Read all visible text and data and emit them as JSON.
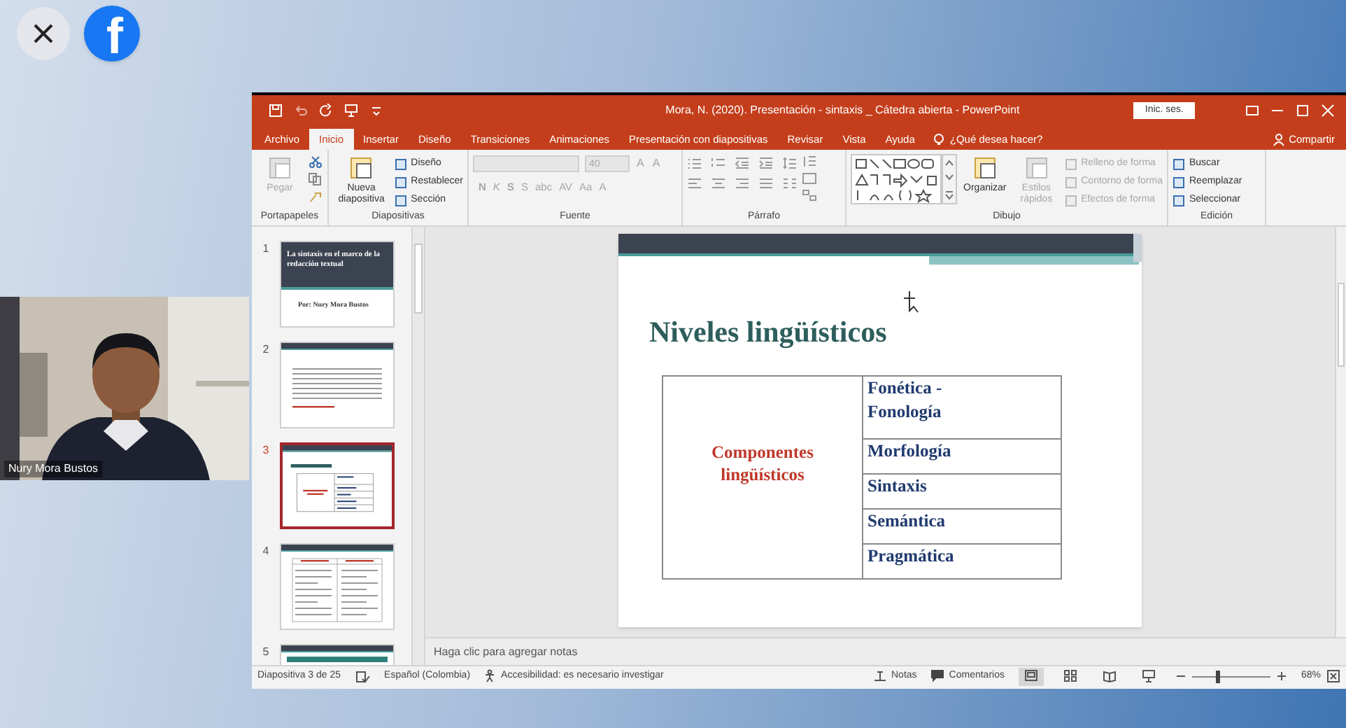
{
  "overlay": {
    "logo_letter": "f"
  },
  "webcam": {
    "name": "Nury Mora Bustos"
  },
  "powerpoint": {
    "title": "Mora, N. (2020). Presentación - sintaxis _ Cátedra abierta - PowerPoint",
    "sign_in": "Inic. ses.",
    "tabs": [
      {
        "label": "Archivo",
        "selected": false
      },
      {
        "label": "Inicio",
        "selected": true
      },
      {
        "label": "Insertar",
        "selected": false
      },
      {
        "label": "Diseño",
        "selected": false
      },
      {
        "label": "Transiciones",
        "selected": false
      },
      {
        "label": "Animaciones",
        "selected": false
      },
      {
        "label": "Presentación con diapositivas",
        "selected": false
      },
      {
        "label": "Revisar",
        "selected": false
      },
      {
        "label": "Vista",
        "selected": false
      },
      {
        "label": "Ayuda",
        "selected": false
      }
    ],
    "tell_me": "¿Qué desea hacer?",
    "share": "Compartir",
    "ribbon": [
      {
        "kind": "clipboard",
        "label": "Portapapeles",
        "items": [
          {
            "kind": "large",
            "label": "Pegar",
            "disabled": true
          }
        ]
      },
      {
        "kind": "slides",
        "label": "Diapositivas",
        "items": [
          {
            "kind": "large",
            "label": "Nueva diapositiva",
            "disabled": false
          },
          {
            "kind": "small",
            "label": "Diseño",
            "disabled": false
          },
          {
            "kind": "small",
            "label": "Restablecer",
            "disabled": false
          },
          {
            "kind": "small",
            "label": "Sección",
            "disabled": false
          }
        ]
      },
      {
        "kind": "font",
        "label": "Fuente",
        "size": "40",
        "row1": [
          "A",
          "A"
        ],
        "row2": [
          "N",
          "K",
          "S",
          "S",
          "abc",
          "AV",
          "Aa",
          "A"
        ]
      },
      {
        "kind": "paragraph",
        "label": "Párrafo"
      },
      {
        "kind": "drawing",
        "label": "Dibujo",
        "items": [
          {
            "kind": "large",
            "label": "Organizar",
            "disabled": false
          },
          {
            "kind": "large",
            "label": "Estilos rápidos",
            "disabled": true
          },
          {
            "kind": "small",
            "label": "Relleno de forma",
            "disabled": true
          },
          {
            "kind": "small",
            "label": "Contorno de forma",
            "disabled": true
          },
          {
            "kind": "small",
            "label": "Efectos de forma",
            "disabled": true
          }
        ]
      },
      {
        "kind": "editing",
        "label": "Edición",
        "items": [
          {
            "kind": "small",
            "label": "Buscar",
            "disabled": false
          },
          {
            "kind": "small",
            "label": "Reemplazar",
            "disabled": false
          },
          {
            "kind": "small",
            "label": "Seleccionar",
            "disabled": false
          }
        ]
      }
    ],
    "slides": [
      {
        "number": "1",
        "kind": "title",
        "selected": false,
        "title": "La sintaxis en el marco de la redacción textual",
        "subtitle": "Por: Nury Mora Bustos"
      },
      {
        "number": "2",
        "kind": "text",
        "selected": false
      },
      {
        "number": "3",
        "kind": "table",
        "selected": true
      },
      {
        "number": "4",
        "kind": "columns",
        "selected": false
      },
      {
        "number": "5",
        "kind": "partial",
        "selected": false
      }
    ],
    "slide": {
      "title": "Niveles lingüísticos",
      "table": {
        "left": "Componentes lingüísticos",
        "rows": [
          "Fonética - Fonología",
          "Morfología",
          "Sintaxis",
          "Semántica",
          "Pragmática"
        ]
      }
    },
    "notes_placeholder": "Haga clic para agregar notas",
    "status_bar": {
      "slide": "Diapositiva 3 de 25",
      "language": "Español (Colombia)",
      "accessibility": "Accesibilidad: es necesario investigar",
      "notes": "Notas",
      "comments": "Comentarios",
      "views": [
        {
          "selected": true
        },
        {
          "selected": false
        },
        {
          "selected": false
        },
        {
          "selected": false
        }
      ],
      "zoom": {
        "level": 0.33,
        "reading": "68%"
      }
    }
  }
}
